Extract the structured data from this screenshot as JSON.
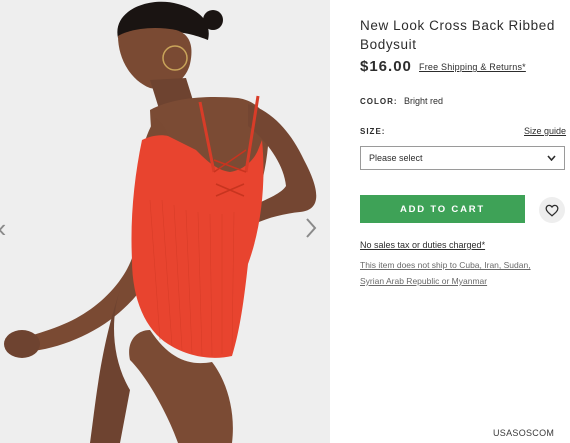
{
  "product": {
    "title": "New Look Cross Back Ribbed Bodysuit",
    "price": "$16.00",
    "shipping_link": "Free Shipping & Returns*"
  },
  "color": {
    "label": "COLOR:",
    "value": "Bright red"
  },
  "size": {
    "label": "SIZE:",
    "guide_link": "Size guide",
    "select_value": "Please select"
  },
  "actions": {
    "add_to_cart": "ADD TO CART"
  },
  "notes": {
    "tax": "No sales tax or duties charged*",
    "shipping_line1": "This item does not ship to Cuba, Iran, Sudan,",
    "shipping_line2": "Syrian Arab Republic or Myanmar"
  },
  "gallery": {
    "prev_icon": "chevron-left-icon",
    "next_icon": "chevron-right-icon"
  },
  "watermark": "USASOSCOM",
  "colors": {
    "accent_green": "#3ea257",
    "swimsuit_red": "#e8442f",
    "photo_bg": "#eeeeee"
  }
}
